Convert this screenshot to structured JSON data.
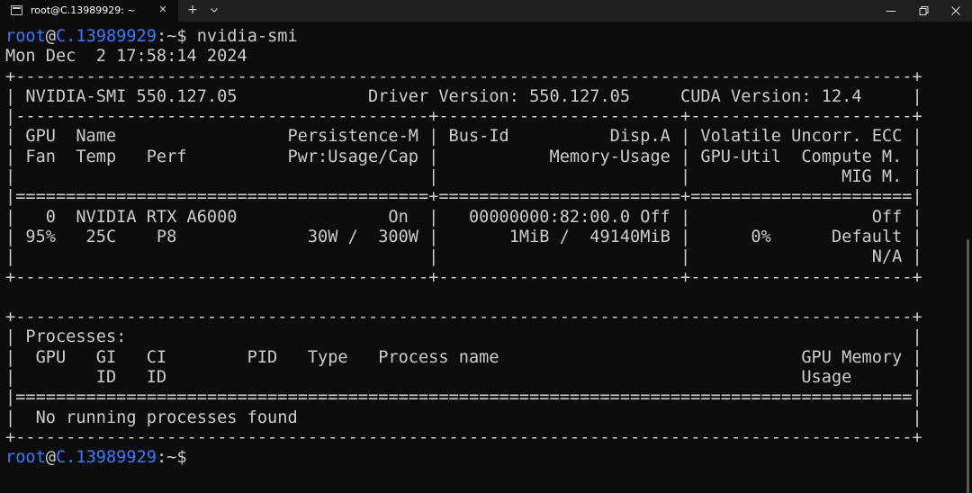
{
  "window": {
    "tab_title": "root@C.13989929: ~",
    "tab_close_glyph": "✕",
    "new_tab_glyph": "+",
    "icons": {
      "tab": "terminal-icon",
      "tab_close": "close-icon",
      "new_tab": "plus-icon",
      "dropdown": "chevron-down-icon",
      "minimize": "minimize-icon",
      "maximize": "restore-icon",
      "close": "close-icon"
    }
  },
  "prompt": {
    "user": "root",
    "at": "@",
    "host": "C.13989929",
    "path_and_symbol": ":~$"
  },
  "command": " nvidia-smi",
  "output_lines": [
    "Mon Dec  2 17:58:14 2024",
    "+-----------------------------------------------------------------------------------------+",
    "| NVIDIA-SMI 550.127.05             Driver Version: 550.127.05     CUDA Version: 12.4     |",
    "|-----------------------------------------+------------------------+----------------------+",
    "| GPU  Name                 Persistence-M | Bus-Id          Disp.A | Volatile Uncorr. ECC |",
    "| Fan  Temp   Perf          Pwr:Usage/Cap |           Memory-Usage | GPU-Util  Compute M. |",
    "|                                         |                        |               MIG M. |",
    "|=========================================+========================+======================|",
    "|   0  NVIDIA RTX A6000               On  |   00000000:82:00.0 Off |                  Off |",
    "| 95%   25C    P8             30W /  300W |       1MiB /  49140MiB |      0%      Default |",
    "|                                         |                        |                  N/A |",
    "+-----------------------------------------+------------------------+----------------------+",
    "",
    "+-----------------------------------------------------------------------------------------+",
    "| Processes:                                                                              |",
    "|  GPU   GI   CI        PID   Type   Process name                              GPU Memory |",
    "|        ID   ID                                                               Usage      |",
    "|=========================================================================================|",
    "|  No running processes found                                                             |",
    "+-----------------------------------------------------------------------------------------+"
  ],
  "colors": {
    "background": "#0c0c0c",
    "titlebar": "#202020",
    "text": "#cccccc",
    "prompt_user": "#3b78ff",
    "prompt_host": "#3b78ff"
  }
}
